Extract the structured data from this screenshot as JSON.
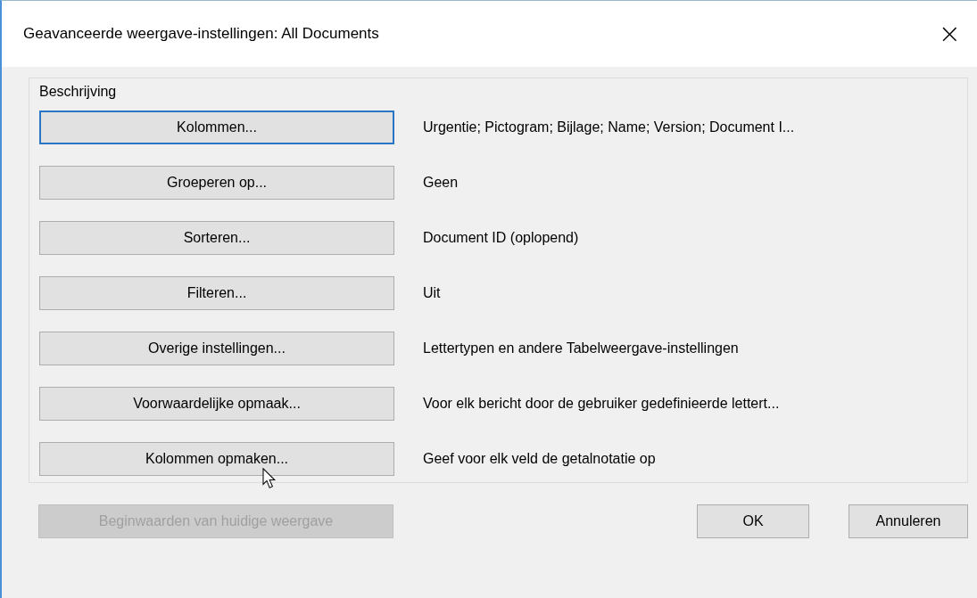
{
  "window": {
    "title": "Geavanceerde weergave-instellingen: All Documents",
    "close": "×"
  },
  "group": {
    "label": "Beschrijving",
    "rows": [
      {
        "button": "Kolommen...",
        "focused": true,
        "description": "Urgentie; Pictogram; Bijlage; Name; Version; Document I..."
      },
      {
        "button": "Groeperen op...",
        "focused": false,
        "description": "Geen"
      },
      {
        "button": "Sorteren...",
        "focused": false,
        "description": "Document ID (oplopend)"
      },
      {
        "button": "Filteren...",
        "focused": false,
        "description": "Uit"
      },
      {
        "button": "Overige instellingen...",
        "focused": false,
        "description": "Lettertypen en andere Tabelweergave-instellingen"
      },
      {
        "button": "Voorwaardelijke opmaak...",
        "focused": false,
        "description": "Voor elk bericht door de gebruiker gedefinieerde lettert..."
      },
      {
        "button": "Kolommen opmaken...",
        "focused": false,
        "description": "Geef voor elk veld de getalnotatie op"
      }
    ]
  },
  "footer": {
    "reset": {
      "label": "Beginwaarden van huidige weergave",
      "disabled": true
    },
    "buttons": [
      "OK",
      "Annuleren"
    ]
  }
}
